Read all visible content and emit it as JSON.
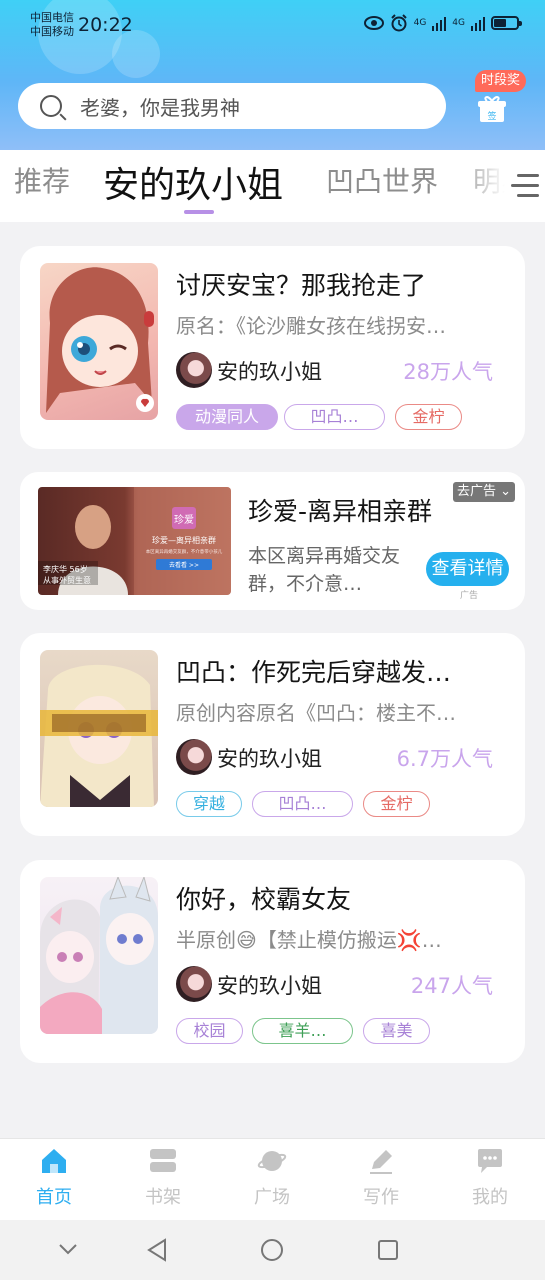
{
  "status": {
    "carrier1": "中国电信",
    "carrier2": "中国移动",
    "time": "20:22",
    "network1": "4G",
    "network2": "4G"
  },
  "search": {
    "placeholder": "老婆，你是我男神"
  },
  "gift": {
    "badge": "时段奖",
    "icon_text": "签"
  },
  "tabs": [
    "推荐",
    "安的玖小姐",
    "凹凸世界",
    "明星"
  ],
  "active_tab": 1,
  "books": [
    {
      "title": "讨厌安宝？那我抢走了",
      "desc": "原名：《论沙雕女孩在线拐安…",
      "author": "安的玖小姐",
      "popularity": "28万人气",
      "tags": [
        "动漫同人",
        "凹凸…",
        "金柠"
      ]
    },
    {
      "title": "凹凸：作死完后穿越发…",
      "desc": "原创内容原名《凹凸：楼主不…",
      "author": "安的玖小姐",
      "popularity": "6.7万人气",
      "tags": [
        "穿越",
        "凹凸…",
        "金柠"
      ]
    },
    {
      "title": "你好，校霸女友",
      "desc": "半原创😅【禁止模仿搬运💢…",
      "author": "安的玖小姐",
      "popularity": "247人气",
      "tags": [
        "校园",
        "喜羊…",
        "喜美"
      ]
    }
  ],
  "ad": {
    "title": "珍爱-离异相亲群",
    "desc": "本区离异再婚交友群，不介意…",
    "button": "查看详情",
    "sub": "广告",
    "close": "去广告",
    "img_caption1": "李庆华 56岁",
    "img_caption2": "从事外贸生意",
    "img_logo": "珍爱",
    "img_heading": "珍爱—离异相亲群",
    "img_small": "本区离异再婚交友群，不介意带小孩儿",
    "img_btn": "去看看 >>"
  },
  "nav": [
    {
      "label": "首页",
      "icon": "home-icon"
    },
    {
      "label": "书架",
      "icon": "bookshelf-icon"
    },
    {
      "label": "广场",
      "icon": "planet-icon"
    },
    {
      "label": "写作",
      "icon": "pen-icon"
    },
    {
      "label": "我的",
      "icon": "chat-icon"
    }
  ],
  "colors": {
    "accent": "#2eaef0",
    "popularity": "#c9a5ec",
    "tab_underline": "#b790e6"
  }
}
